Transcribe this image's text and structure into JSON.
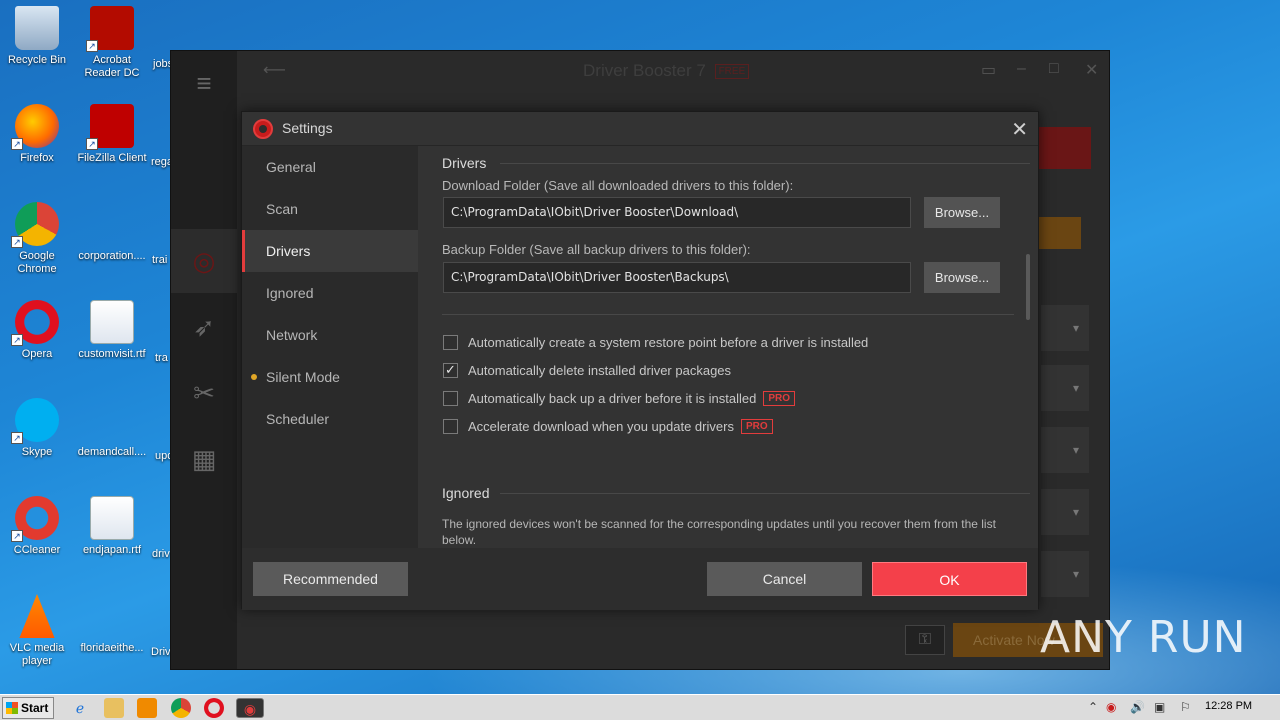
{
  "desktop": {
    "icons": [
      {
        "name": "recycle-bin",
        "label": "Recycle Bin"
      },
      {
        "name": "acrobat",
        "label": "Acrobat Reader DC"
      },
      {
        "name": "firefox",
        "label": "Firefox"
      },
      {
        "name": "filezilla",
        "label": "FileZilla Client"
      },
      {
        "name": "chrome",
        "label": "Google Chrome"
      },
      {
        "name": "corporation",
        "label": "corporation...."
      },
      {
        "name": "opera",
        "label": "Opera"
      },
      {
        "name": "customvisit",
        "label": "customvisit.rtf"
      },
      {
        "name": "skype",
        "label": "Skype"
      },
      {
        "name": "demandcall",
        "label": "demandcall...."
      },
      {
        "name": "ccleaner",
        "label": "CCleaner"
      },
      {
        "name": "endjapan",
        "label": "endjapan.rtf"
      },
      {
        "name": "vlc",
        "label": "VLC media player"
      },
      {
        "name": "floridaeithe",
        "label": "floridaeithe..."
      }
    ],
    "partial_labels": [
      "jobs",
      "rega",
      "trai",
      "tra",
      "upd",
      "driv",
      "Driv"
    ]
  },
  "app": {
    "title": "Driver Booster 7",
    "edition": "FREE",
    "activate": "Activate Now"
  },
  "dialog": {
    "title": "Settings",
    "nav": [
      {
        "label": "General",
        "active": false,
        "dot": false
      },
      {
        "label": "Scan",
        "active": false,
        "dot": false
      },
      {
        "label": "Drivers",
        "active": true,
        "dot": false
      },
      {
        "label": "Ignored",
        "active": false,
        "dot": false
      },
      {
        "label": "Network",
        "active": false,
        "dot": false
      },
      {
        "label": "Silent Mode",
        "active": false,
        "dot": true
      },
      {
        "label": "Scheduler",
        "active": false,
        "dot": false
      }
    ],
    "drivers": {
      "heading": "Drivers",
      "download_label": "Download Folder (Save all downloaded drivers to this folder):",
      "download_path": "C:\\ProgramData\\IObit\\Driver Booster\\Download\\",
      "backup_label": "Backup Folder (Save all backup drivers to this folder):",
      "backup_path": "C:\\ProgramData\\IObit\\Driver Booster\\Backups\\",
      "browse_label": "Browse...",
      "options": [
        {
          "label": "Automatically create a system restore point before a driver is installed",
          "checked": false,
          "pro": false
        },
        {
          "label": "Automatically delete installed driver packages",
          "checked": true,
          "pro": false
        },
        {
          "label": "Automatically back up a driver before it is installed",
          "checked": false,
          "pro": true
        },
        {
          "label": "Accelerate download when you update drivers",
          "checked": false,
          "pro": true
        }
      ],
      "pro_badge": "PRO"
    },
    "ignored": {
      "heading": "Ignored",
      "description": "The ignored devices won't be scanned for the corresponding updates until you recover them from the list below."
    },
    "footer": {
      "recommended": "Recommended",
      "cancel": "Cancel",
      "ok": "OK"
    }
  },
  "taskbar": {
    "start": "Start",
    "clock": "12:28 PM"
  },
  "watermark": "ANY RUN",
  "colors": {
    "accent_red": "#f4404a",
    "pro_red": "#e23c3c",
    "dot_amber": "#e0a626"
  }
}
